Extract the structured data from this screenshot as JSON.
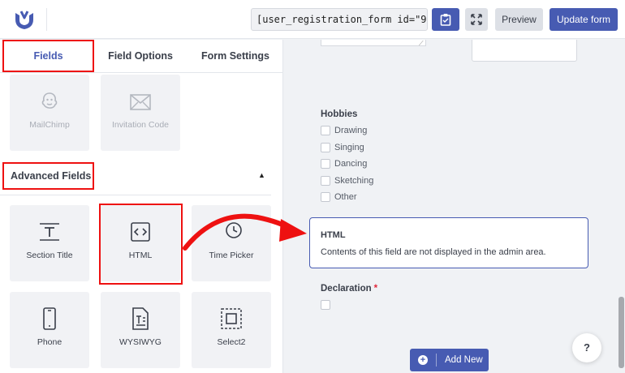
{
  "topbar": {
    "logo_icon": "user-registration-logo-icon",
    "shortcode": "[user_registration_form id=\"9\"]",
    "copy_icon": "clipboard-icon",
    "expand_icon": "expand-icon",
    "preview_label": "Preview",
    "update_label": "Update form",
    "accent_color": "#475bb2"
  },
  "tabs": {
    "fields": "Fields",
    "field_options": "Field Options",
    "form_settings": "Form Settings"
  },
  "upper_fields": [
    {
      "label": "MailChimp",
      "icon": "mailchimp-icon",
      "disabled": true
    },
    {
      "label": "Invitation Code",
      "icon": "invitation-envelope-icon",
      "disabled": true
    }
  ],
  "advanced": {
    "title": "Advanced Fields",
    "collapse_icon": "caret-up-icon",
    "fields": [
      {
        "label": "Section Title",
        "icon": "section-title-icon"
      },
      {
        "label": "HTML",
        "icon": "code-icon"
      },
      {
        "label": "Time Picker",
        "icon": "clock-icon"
      },
      {
        "label": "Phone",
        "icon": "phone-icon"
      },
      {
        "label": "WYSIWYG",
        "icon": "wysiwyg-document-icon"
      },
      {
        "label": "Select2",
        "icon": "select2-icon"
      }
    ]
  },
  "form": {
    "hobbies": {
      "label": "Hobbies",
      "options": [
        "Drawing",
        "Singing",
        "Dancing",
        "Sketching",
        "Other"
      ]
    },
    "html_field": {
      "title": "HTML",
      "description": "Contents of this field are not displayed in the admin area."
    },
    "declaration": {
      "label": "Declaration",
      "required_mark": "*"
    },
    "add_new_label": "Add New",
    "help_label": "?"
  },
  "highlight_color": "#ee1111"
}
